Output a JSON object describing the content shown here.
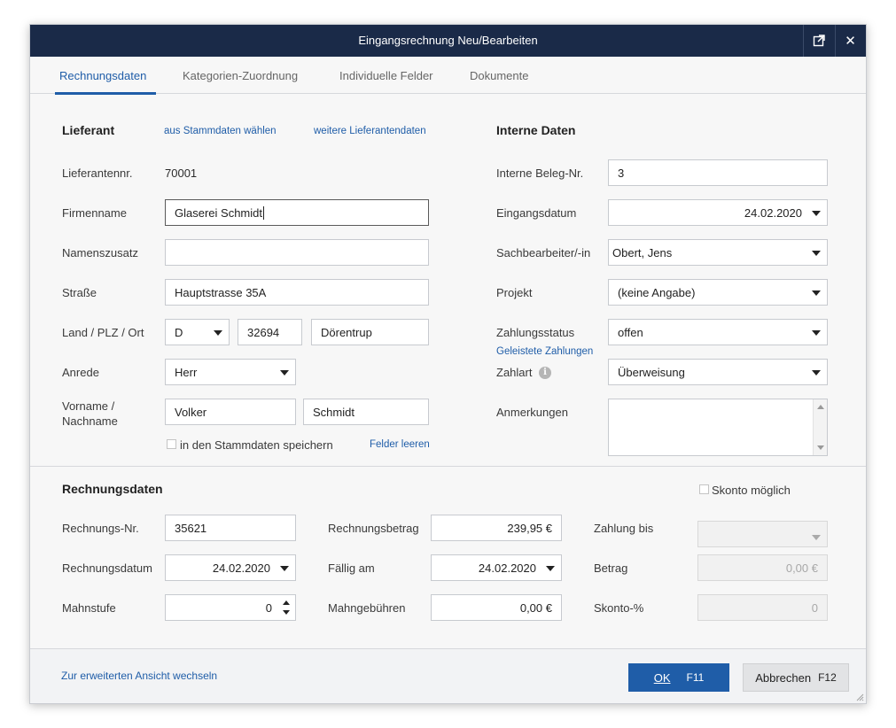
{
  "window": {
    "title": "Eingangsrechnung Neu/Bearbeiten"
  },
  "tabs": [
    {
      "label": "Rechnungsdaten"
    },
    {
      "label": "Kategorien-Zuordnung"
    },
    {
      "label": "Individuelle Felder"
    },
    {
      "label": "Dokumente"
    }
  ],
  "supplier": {
    "heading": "Lieferant",
    "link_master": "aus Stammdaten wählen",
    "link_more": "weitere Lieferantendaten",
    "number_label": "Lieferantennr.",
    "number_value": "70001",
    "company_label": "Firmenname",
    "company_value": "Glaserei Schmidt",
    "name_suffix_label": "Namenszusatz",
    "name_suffix_value": "",
    "street_label": "Straße",
    "street_value": "Hauptstrasse 35A",
    "location_label": "Land / PLZ / Ort",
    "country_value": "D",
    "zip_value": "32694",
    "city_value": "Dörentrup",
    "salutation_label": "Anrede",
    "salutation_value": "Herr",
    "name_label_1": "Vorname /",
    "name_label_2": "Nachname",
    "firstname_value": "Volker",
    "lastname_value": "Schmidt",
    "save_master_label": "in den Stammdaten speichern",
    "clear_fields_link": "Felder leeren"
  },
  "internal": {
    "heading": "Interne Daten",
    "doc_no_label": "Interne Beleg-Nr.",
    "doc_no_value": "3",
    "received_label": "Eingangsdatum",
    "received_value": "24.02.2020",
    "clerk_label": "Sachbearbeiter/-in",
    "clerk_value": "Obert, Jens",
    "project_label": "Projekt",
    "project_value": "(keine Angabe)",
    "payment_status_label": "Zahlungsstatus",
    "payment_status_value": "offen",
    "payments_link": "Geleistete Zahlungen",
    "payment_method_label": "Zahlart",
    "payment_method_value": "Überweisung",
    "notes_label": "Anmerkungen",
    "notes_value": ""
  },
  "invoice": {
    "heading": "Rechnungsdaten",
    "discount_possible_label": "Skonto möglich",
    "number_label": "Rechnungs-Nr.",
    "number_value": "35621",
    "date_label": "Rechnungsdatum",
    "date_value": "24.02.2020",
    "dunning_label": "Mahnstufe",
    "dunning_value": "0",
    "amount_label": "Rechnungsbetrag",
    "amount_value": "239,95 €",
    "due_label": "Fällig am",
    "due_value": "24.02.2020",
    "dunning_fee_label": "Mahngebühren",
    "dunning_fee_value": "0,00 €",
    "pay_until_label": "Zahlung bis",
    "pay_until_value": "",
    "discount_amount_label": "Betrag",
    "discount_amount_value": "0,00 €",
    "discount_pct_label": "Skonto-%",
    "discount_pct_value": "0"
  },
  "footer": {
    "extended_view_link": "Zur erweiterten Ansicht wechseln",
    "ok_label": "OK",
    "ok_key": "F11",
    "cancel_label": "Abbrechen",
    "cancel_key": "F12"
  },
  "colors": {
    "titlebar": "#1a2a48",
    "accent": "#1f5da8",
    "dialog_bg": "#f7f7f7"
  },
  "icons": {
    "external": "external-window-icon",
    "close": "close-icon",
    "info": "info-icon",
    "dropdown": "chevron-down-icon"
  }
}
